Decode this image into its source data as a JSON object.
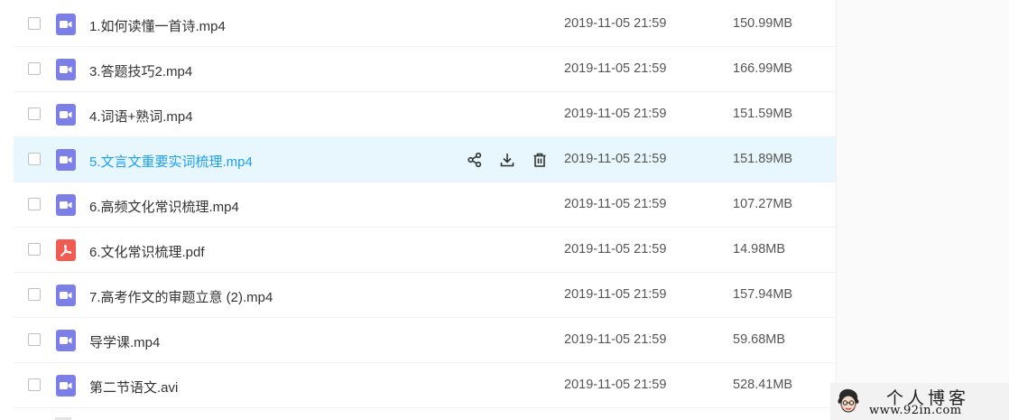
{
  "files": [
    {
      "name": "1.如何读懂一首诗.mp4",
      "date": "2019-11-05 21:59",
      "size": "150.99MB",
      "type": "video"
    },
    {
      "name": "3.答题技巧2.mp4",
      "date": "2019-11-05 21:59",
      "size": "166.99MB",
      "type": "video"
    },
    {
      "name": "4.词语+熟词.mp4",
      "date": "2019-11-05 21:59",
      "size": "151.59MB",
      "type": "video"
    },
    {
      "name": "5.文言文重要实词梳理.mp4",
      "date": "2019-11-05 21:59",
      "size": "151.89MB",
      "type": "video",
      "hovered": true
    },
    {
      "name": "6.高频文化常识梳理.mp4",
      "date": "2019-11-05 21:59",
      "size": "107.27MB",
      "type": "video"
    },
    {
      "name": "6.文化常识梳理.pdf",
      "date": "2019-11-05 21:59",
      "size": "14.98MB",
      "type": "pdf"
    },
    {
      "name": "7.高考作文的审题立意 (2).mp4",
      "date": "2019-11-05 21:59",
      "size": "157.94MB",
      "type": "video"
    },
    {
      "name": "导学课.mp4",
      "date": "2019-11-05 21:59",
      "size": "59.68MB",
      "type": "video"
    },
    {
      "name": "第二节语文.avi",
      "date": "2019-11-05 21:59",
      "size": "528.41MB",
      "type": "video"
    }
  ],
  "row_actions": [
    "share-icon",
    "download-icon",
    "delete-icon"
  ],
  "watermark": {
    "title": "个人博客",
    "url": "www.92in.com"
  },
  "colors": {
    "video_icon": "#7d7fe9",
    "pdf_icon": "#f15b52",
    "hover_row": "#e8f6fd",
    "hover_text": "#1ea0f0"
  }
}
